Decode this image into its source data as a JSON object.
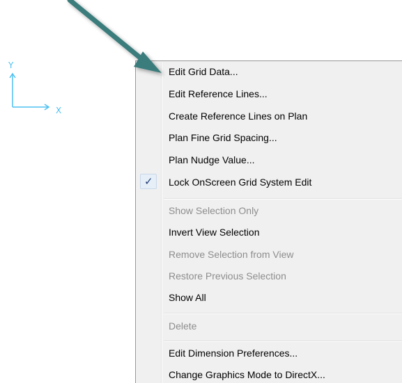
{
  "axis": {
    "y_label": "Y",
    "x_label": "X",
    "color": "#4dc0f0"
  },
  "pointer": {
    "icon": "arrow-pointer-icon",
    "color": "#3a7b7b"
  },
  "context_menu": {
    "groups": [
      {
        "items": [
          {
            "label": "Edit Grid Data...",
            "enabled": true,
            "checked": false
          },
          {
            "label": "Edit Reference Lines...",
            "enabled": true,
            "checked": false
          },
          {
            "label": "Create Reference Lines on Plan",
            "enabled": true,
            "checked": false
          },
          {
            "label": "Plan Fine Grid Spacing...",
            "enabled": true,
            "checked": false
          },
          {
            "label": "Plan Nudge Value...",
            "enabled": true,
            "checked": false
          },
          {
            "label": "Lock OnScreen Grid System Edit",
            "enabled": true,
            "checked": true
          }
        ]
      },
      {
        "items": [
          {
            "label": "Show Selection Only",
            "enabled": false,
            "checked": false
          },
          {
            "label": "Invert View Selection",
            "enabled": true,
            "checked": false
          },
          {
            "label": "Remove Selection from View",
            "enabled": false,
            "checked": false
          },
          {
            "label": "Restore Previous Selection",
            "enabled": false,
            "checked": false
          },
          {
            "label": "Show All",
            "enabled": true,
            "checked": false
          }
        ]
      },
      {
        "items": [
          {
            "label": "Delete",
            "enabled": false,
            "checked": false
          }
        ]
      },
      {
        "items": [
          {
            "label": "Edit Dimension Preferences...",
            "enabled": true,
            "checked": false
          },
          {
            "label": "Change Graphics Mode to DirectX...",
            "enabled": true,
            "checked": false
          }
        ]
      }
    ],
    "check_glyph": "✓"
  }
}
